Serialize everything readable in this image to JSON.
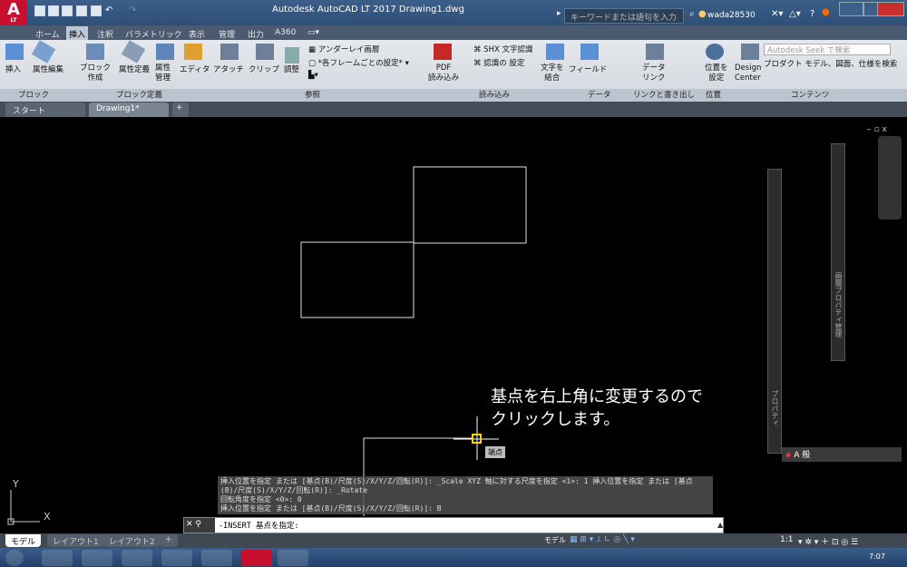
{
  "app": {
    "title": "Autodesk AutoCAD LT 2017    Drawing1.dwg",
    "logo": "A",
    "logo_sub": "LT"
  },
  "search": {
    "placeholder": "キーワードまたは語句を入力"
  },
  "user": {
    "name": "wada28530"
  },
  "ribbon_tabs": [
    "ホーム",
    "挿入",
    "注釈",
    "パラメトリック",
    "表示",
    "管理",
    "出力",
    "A360"
  ],
  "ribbon_tab_active": "挿入",
  "ribbon_buttons": {
    "insert": "挿入",
    "attr_edit": "属性編集",
    "block_create": "ブロック\n作成",
    "attr_define": "属性定義",
    "attr_manage": "属性\n管理",
    "editor": "エディタ",
    "attach": "アタッチ",
    "clip": "クリップ",
    "adjust": "調整",
    "underlay_layer": "アンダーレイ画層",
    "frame_setting": "*各フレームごとの設定*",
    "pdf_import": "PDF\n読み込み",
    "shx_recognize": "SHX 文字認識",
    "recognize_setting": "認識の 設定",
    "text_combine": "文字を\n結合",
    "field": "フィールド",
    "data_link": "データ\nリンク",
    "location": "位置を\n設定",
    "design_center": "Design\nCenter",
    "seek_search": "Autodesk Seek で検索",
    "product_models": "プロダクト モデル、図面、仕様を検索"
  },
  "panels": [
    "ブロック",
    "ブロック定義",
    "参照",
    "読み込み",
    "データ",
    "リンクと書き出し",
    "位置",
    "コンテンツ"
  ],
  "file_tabs": [
    "スタート",
    "Drawing1*"
  ],
  "annotation": "基点を右上角に変更するので\nクリックします。",
  "tooltip": "端点",
  "command_history": [
    "挿入位置を指定 または [基点(B)/尺度(S)/X/Y/Z/回転(R)]: _Scale XYZ 軸に対する尺度を指定 <1>: 1 挿入位置を指定 または [基点",
    "(B)/尺度(S)/X/Y/Z/回転(R)]: _Rotate",
    "回転角度を指定 <0>: 0",
    "挿入位置を指定 または [基点(B)/尺度(S)/X/Y/Z/回転(R)]: B"
  ],
  "command_line": "-INSERT 基点を指定:",
  "ucs": {
    "x": "X",
    "y": "Y"
  },
  "side_labels": {
    "properties": "プロパティ",
    "layer_properties": "画層プロパティ管理"
  },
  "status_tabs": [
    "モデル",
    "レイアウト1",
    "レイアウト2"
  ],
  "status_right": "モデル",
  "scale": "1:1",
  "tray_text": "A 般",
  "clock": "7:07",
  "colors": {
    "accent": "#c8102e",
    "canvas": "#000000",
    "titlebar": "#2d4f78",
    "osnap_marker": "#ffd400"
  }
}
